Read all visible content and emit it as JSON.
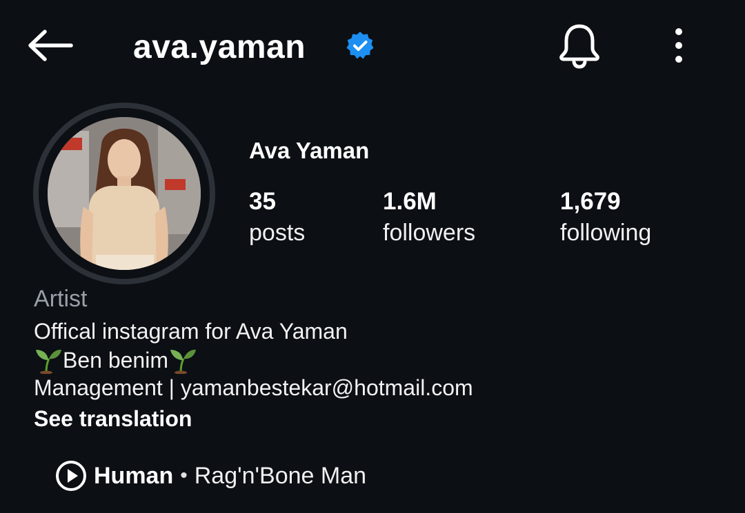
{
  "header": {
    "back_icon": "arrow-left-icon",
    "username": "ava.yaman",
    "verified_icon": "verified-badge-icon",
    "notification_icon": "bell-icon",
    "more_icon": "more-vertical-icon"
  },
  "profile": {
    "display_name": "Ava Yaman",
    "avatar_icon": "profile-photo",
    "stats": [
      {
        "value": "35",
        "label": "posts"
      },
      {
        "value": "1.6M",
        "label": "followers"
      },
      {
        "value": "1,679",
        "label": "following"
      }
    ]
  },
  "bio": {
    "category": "Artist",
    "line1": "Offical instagram for Ava Yaman",
    "line2_text": "Ben benim",
    "line3": "Management | yamanbestekar@hotmail.com",
    "see_translation": "See translation"
  },
  "music": {
    "icon": "play-circle-icon",
    "title": "Human",
    "separator": "•",
    "artist": "Rag'n'Bone Man"
  },
  "colors": {
    "background": "#0c0f14",
    "verified": "#1d8ff2",
    "muted": "#9aa0a8"
  }
}
